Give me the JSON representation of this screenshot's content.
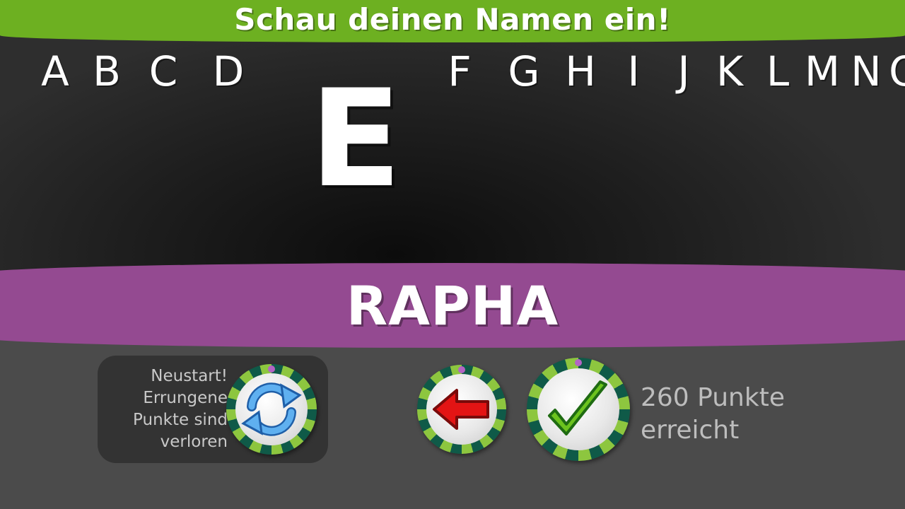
{
  "header": {
    "title": "Schau deinen Namen ein!"
  },
  "alphabet": {
    "letters": [
      "A",
      "B",
      "C",
      "D",
      "F",
      "G",
      "H",
      "I",
      "J",
      "K",
      "L",
      "M",
      "N",
      "O"
    ],
    "selected": "E"
  },
  "name": {
    "value": "RAPHA"
  },
  "restart": {
    "text": "Neustart! Errungene Punkte sind verloren",
    "lines": [
      "Neustart!",
      "Errungene",
      "Punkte sind",
      "verloren"
    ],
    "icon": "refresh-icon"
  },
  "back": {
    "icon": "red-arrow-left-icon"
  },
  "confirm": {
    "icon": "green-checkmark-icon"
  },
  "score": {
    "lines": [
      "260 Punkte",
      "erreicht"
    ]
  },
  "colors": {
    "header": "#6db021",
    "name_band": "#944a91",
    "ring_dark": "#0f5a48",
    "ring_light": "#8dc63f",
    "panel": "#333333"
  }
}
